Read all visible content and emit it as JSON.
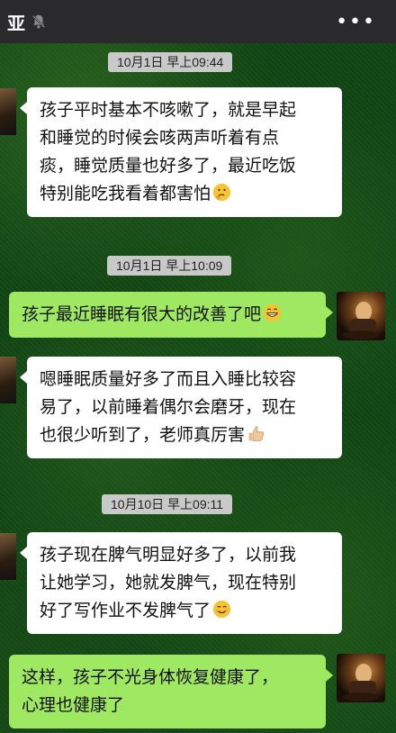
{
  "header": {
    "title": "亚",
    "mute_icon": "bell-muted-icon",
    "more_icon": "more-dots-icon",
    "more_label": "•••"
  },
  "messages": [
    {
      "type": "time",
      "text": "10月1日 早上09:44"
    },
    {
      "type": "in",
      "lines": [
        "孩子平时基本不咳嗽了，就是早起",
        "和睡觉的时候会咳两声听着有点",
        "痰，睡觉质量也好多了，最近吃饭",
        "特别能吃我看着都害怕"
      ],
      "emoji": "thinking-face-icon"
    },
    {
      "type": "time",
      "text": "10月1日 早上10:09"
    },
    {
      "type": "out",
      "lines": [
        "孩子最近睡眠有很大的改善了吧"
      ],
      "emoji": "grinning-face-icon"
    },
    {
      "type": "in",
      "lines": [
        "嗯睡眠质量好多了而且入睡比较容",
        "易了，以前睡着偶尔会磨牙，现在",
        "也很少听到了，老师真厉害"
      ],
      "emoji": "thumbs-up-icon"
    },
    {
      "type": "time",
      "text": "10月10日 早上09:11"
    },
    {
      "type": "in",
      "lines": [
        "孩子现在脾气明显好多了，以前我",
        "让她学习，她就发脾气，现在特别",
        "好了写作业不发脾气了"
      ],
      "emoji": "smiling-face-icon"
    },
    {
      "type": "out",
      "lines": [
        "这样，孩子不光身体恢复健康了，",
        "心理也健康了"
      ],
      "emoji": ""
    }
  ],
  "colors": {
    "incoming": "#ffffff",
    "outgoing": "#9fe862",
    "header": "#2a2a2d",
    "timestamp": "#c9c9c9"
  }
}
